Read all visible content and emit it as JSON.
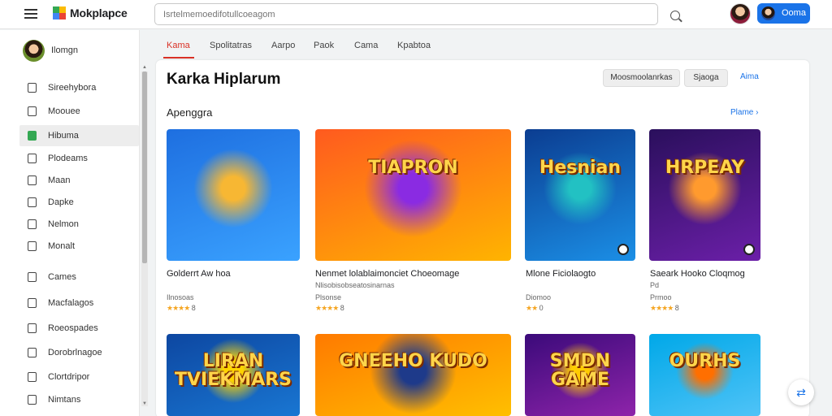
{
  "app": {
    "title": "Mokplapce"
  },
  "search": {
    "placeholder": "Isrtelmemoedifotullcoeagom"
  },
  "account": {
    "label": "Ooma"
  },
  "sidebar": {
    "profile_name": "Ilomgn",
    "items": [
      {
        "label": "Sireehybora",
        "icon": "home-icon"
      },
      {
        "label": "Moouee",
        "icon": "arrow-box-icon"
      },
      {
        "label": "Hibuma",
        "icon": "green-store-icon",
        "active": true
      },
      {
        "label": "Plodeams",
        "icon": "folder-icon"
      },
      {
        "label": "Maan",
        "icon": "square-icon"
      },
      {
        "label": "Dapke",
        "icon": "house-icon"
      },
      {
        "label": "Nelmon",
        "icon": "list-icon"
      },
      {
        "label": "Monalt",
        "icon": "pen-icon"
      },
      {
        "label": "Cames",
        "icon": "gamepad-icon"
      },
      {
        "label": "Macfalagos",
        "icon": "doc-icon"
      },
      {
        "label": "Roeospades",
        "icon": "box-icon"
      },
      {
        "label": "Dorobrlnagoe",
        "icon": "clock-icon"
      },
      {
        "label": "Clortdripor",
        "icon": "calendar-icon"
      },
      {
        "label": "Nimtans",
        "icon": "bookmark-icon"
      }
    ]
  },
  "tabs": [
    "Kama",
    "Spolitatras",
    "Aarpo",
    "Paok",
    "Cama",
    "Kpabtoa"
  ],
  "page": {
    "title": "Karka Hiplarum",
    "btn_one": "Moosmoolanrkas",
    "btn_two": "Sjaoga",
    "btn_link": "Aima",
    "section_title": "Apenggra",
    "see_more": "Plame ›"
  },
  "cards": [
    {
      "title": "Golderrt Aw hoa",
      "sub": "Ilnosoas",
      "rating_stars": "★★★★",
      "rating_text": "8"
    },
    {
      "title": "Nenmet lolablaimonciet Choeomage",
      "sub": "Nlisobisobseatosinarnas",
      "sub2": "Plsonse",
      "rating_stars": "★★★★",
      "rating_text": "8"
    },
    {
      "title": "Mlone Ficiolaogto",
      "sub": "Diomoo",
      "rating_stars": "★★",
      "rating_text": "0"
    },
    {
      "title": "Saeark Hooko Cloqmog",
      "sub": "Pd",
      "sub2": "Prmoo",
      "rating_stars": "★★★★",
      "rating_text": "8"
    }
  ],
  "art": [
    {
      "text": "",
      "colors": [
        "#1e6fe0",
        "#3aa2ff",
        "#f7b733"
      ]
    },
    {
      "text": "TIAPRON",
      "colors": [
        "#ff5a1f",
        "#ffb400",
        "#8a2be2"
      ]
    },
    {
      "text": "Hesnian",
      "colors": [
        "#0b3d91",
        "#1b8fe6",
        "#22c1c3"
      ]
    },
    {
      "text": "HRPEAY",
      "colors": [
        "#2a0f5c",
        "#6b1fa8",
        "#ff9a2e"
      ]
    },
    {
      "text": "LIRAN TVIEKMARS",
      "colors": [
        "#0d47a1",
        "#1976d2",
        "#ffd400"
      ]
    },
    {
      "text": "GNEEHO KUDO",
      "colors": [
        "#ff7a00",
        "#ffbf00",
        "#1e3a8a"
      ]
    },
    {
      "text": "SMDN GAME",
      "colors": [
        "#3b0a7a",
        "#8e24aa",
        "#ffcc00"
      ]
    },
    {
      "text": "OURHS",
      "colors": [
        "#00a8e8",
        "#4fc3f7",
        "#ff6f00"
      ]
    }
  ],
  "colors": {
    "accent": "#1a73e8",
    "active_tab": "#d93025",
    "nav_active": "#34a853"
  }
}
